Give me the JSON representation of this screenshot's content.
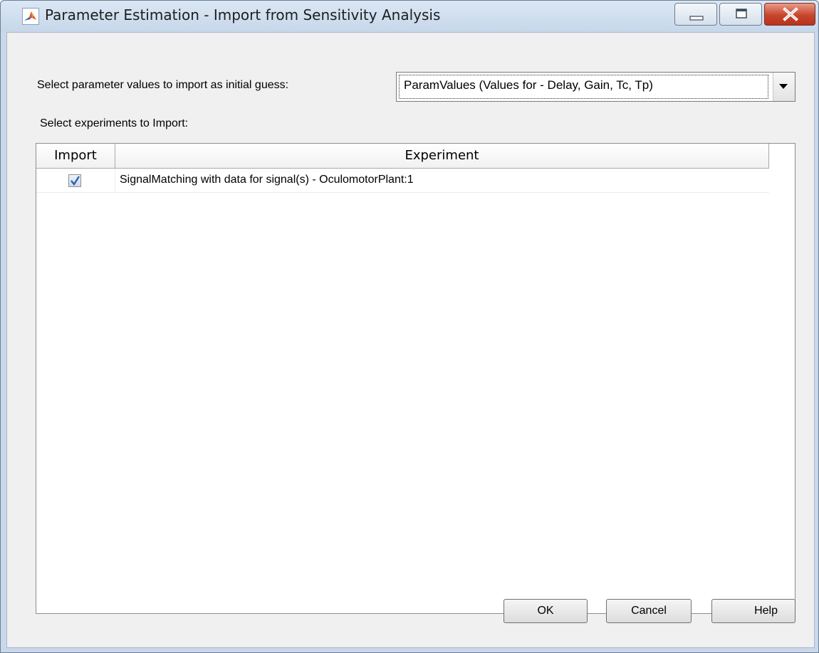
{
  "window": {
    "title": "Parameter Estimation - Import from Sensitivity Analysis",
    "app_icon": "matlab-icon",
    "controls": [
      "minimize-icon",
      "maximize-icon",
      "close-icon"
    ]
  },
  "param_select": {
    "label": "Select parameter values to import as initial guess:",
    "value": "ParamValues (Values for - Delay, Gain, Tc, Tp)"
  },
  "experiments": {
    "label": "Select experiments to Import:",
    "columns": [
      "Import",
      "Experiment"
    ],
    "rows": [
      {
        "import": true,
        "experiment": "SignalMatching with data for signal(s) - OculomotorPlant:1"
      }
    ]
  },
  "buttons": {
    "ok": "OK",
    "cancel": "Cancel",
    "help": "Help"
  },
  "colors": {
    "title_bar": "#c6d7ea",
    "client_bg": "#f0f0f0",
    "close_button": "#c7452d"
  }
}
